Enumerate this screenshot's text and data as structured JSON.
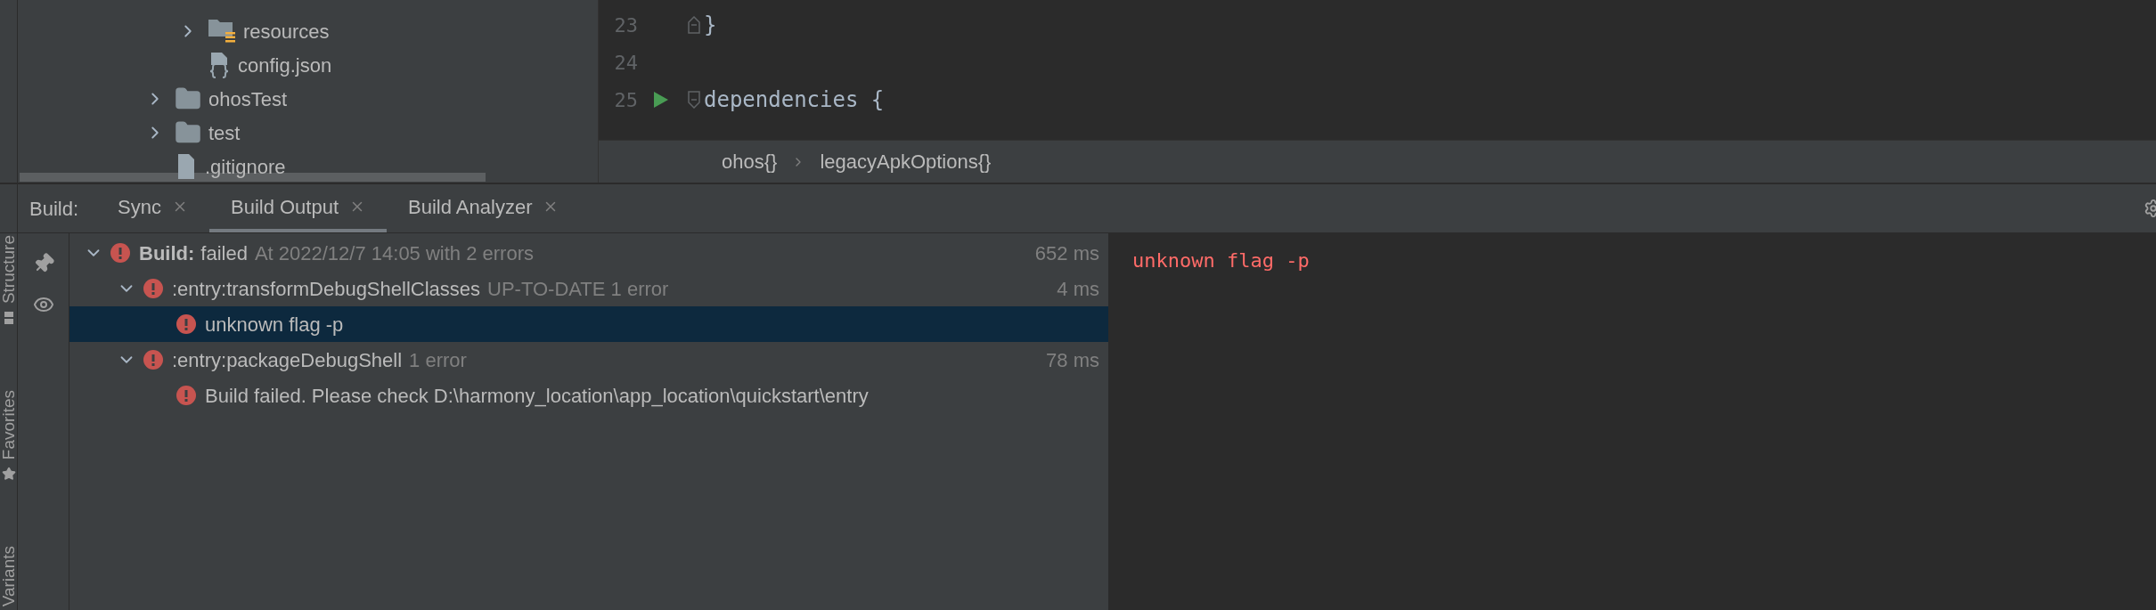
{
  "side_tabs": [
    {
      "label": "Structure",
      "kind": "structure"
    },
    {
      "label": "Favorites",
      "kind": "favorites"
    },
    {
      "label": "Variants",
      "kind": "variants"
    }
  ],
  "project_tree": [
    {
      "kind": "group",
      "children": [
        {
          "label": "resources",
          "kind": "resources_folder",
          "expanded": false
        },
        {
          "label": "config.json",
          "kind": "json_file"
        }
      ]
    },
    {
      "label": "ohosTest",
      "kind": "folder",
      "expanded": false
    },
    {
      "label": "test",
      "kind": "folder",
      "expanded": false
    },
    {
      "label": ".gitignore",
      "kind": "file"
    }
  ],
  "editor": {
    "lines": [
      {
        "number": "23",
        "kind": "block_end",
        "code": "}"
      },
      {
        "number": "24",
        "kind": "blank"
      },
      {
        "number": "25",
        "kind": "block_start",
        "run": true,
        "code": "dependencies {"
      }
    ],
    "breadcrumbs": [
      "ohos{}",
      "legacyApkOptions{}"
    ]
  },
  "build_panel": {
    "label": "Build:",
    "tabs": [
      {
        "label": "Sync",
        "selected": false
      },
      {
        "label": "Build Output",
        "selected": true
      },
      {
        "label": "Build Analyzer",
        "selected": false
      }
    ],
    "tree": [
      {
        "kind": "error",
        "title": "Build:",
        "text": "failed",
        "detail": "At 2022/12/7 14:05 with 2 errors",
        "time": "652 ms",
        "expanded": true,
        "selected": false,
        "children": [
          {
            "kind": "error",
            "text": ":entry:transformDebugShellClasses",
            "detail": "UP-TO-DATE 1 error",
            "time": "4 ms",
            "expanded": true,
            "selected": false,
            "children": [
              {
                "kind": "error",
                "text": "unknown flag -p",
                "selected": true
              }
            ]
          },
          {
            "kind": "error",
            "text": ":entry:packageDebugShell",
            "detail": "1 error",
            "time": "78 ms",
            "expanded": true,
            "selected": false,
            "children": [
              {
                "kind": "error",
                "text": "Build failed. Please check D:\\harmony_location\\app_location\\quickstart\\entry",
                "selected": false
              }
            ]
          }
        ]
      }
    ],
    "console": [
      {
        "text": "unknown flag -p",
        "kind": "error"
      }
    ]
  }
}
